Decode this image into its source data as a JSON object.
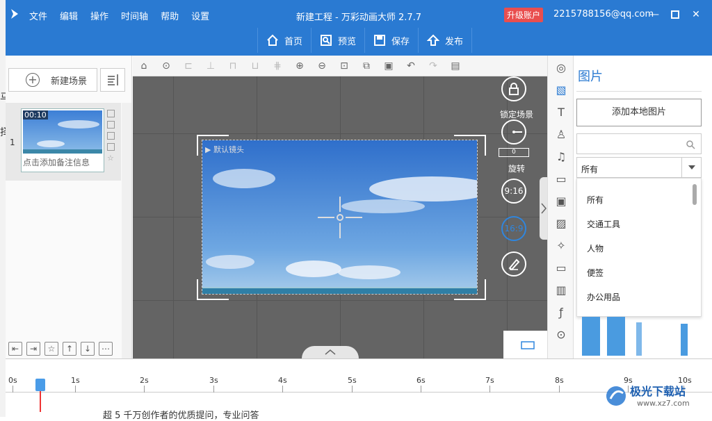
{
  "titlebar": {
    "menu": [
      "文件",
      "编辑",
      "操作",
      "时间轴",
      "帮助",
      "设置"
    ],
    "title": "新建工程 - 万彩动画大师 2.7.7",
    "upgrade": "升级账户",
    "account": "2215788156@qq.com",
    "accent": "#2a7ad2"
  },
  "toolbar": {
    "home": "首页",
    "preview": "预览",
    "save": "保存",
    "publish": "发布"
  },
  "scene_panel": {
    "new_scene": "新建场景",
    "scene_number": "1",
    "scene_time": "00:10",
    "scene_note": "点击添加备注信息"
  },
  "canvas": {
    "camera_label": "默认镜头",
    "lock_label": "锁定场景",
    "rotate_value": "0",
    "rotate_label": "旋转",
    "ratio_916": "9:16",
    "ratio_169": "16:9"
  },
  "image_panel": {
    "title": "图片",
    "add_local": "添加本地图片",
    "category_selected": "所有",
    "options": [
      "所有",
      "交通工具",
      "人物",
      "便签",
      "办公用品"
    ]
  },
  "timeline": {
    "ticks": [
      "0s",
      "1s",
      "2s",
      "3s",
      "4s",
      "5s",
      "6s",
      "7s",
      "8s",
      "9s",
      "10s"
    ],
    "below_text": "超 5 千万创作者的优质提问，专业问答"
  },
  "outer_left_text": [
    "马",
    "择"
  ],
  "watermark": {
    "name": "极光下载站",
    "url": "www.xz7.com"
  }
}
